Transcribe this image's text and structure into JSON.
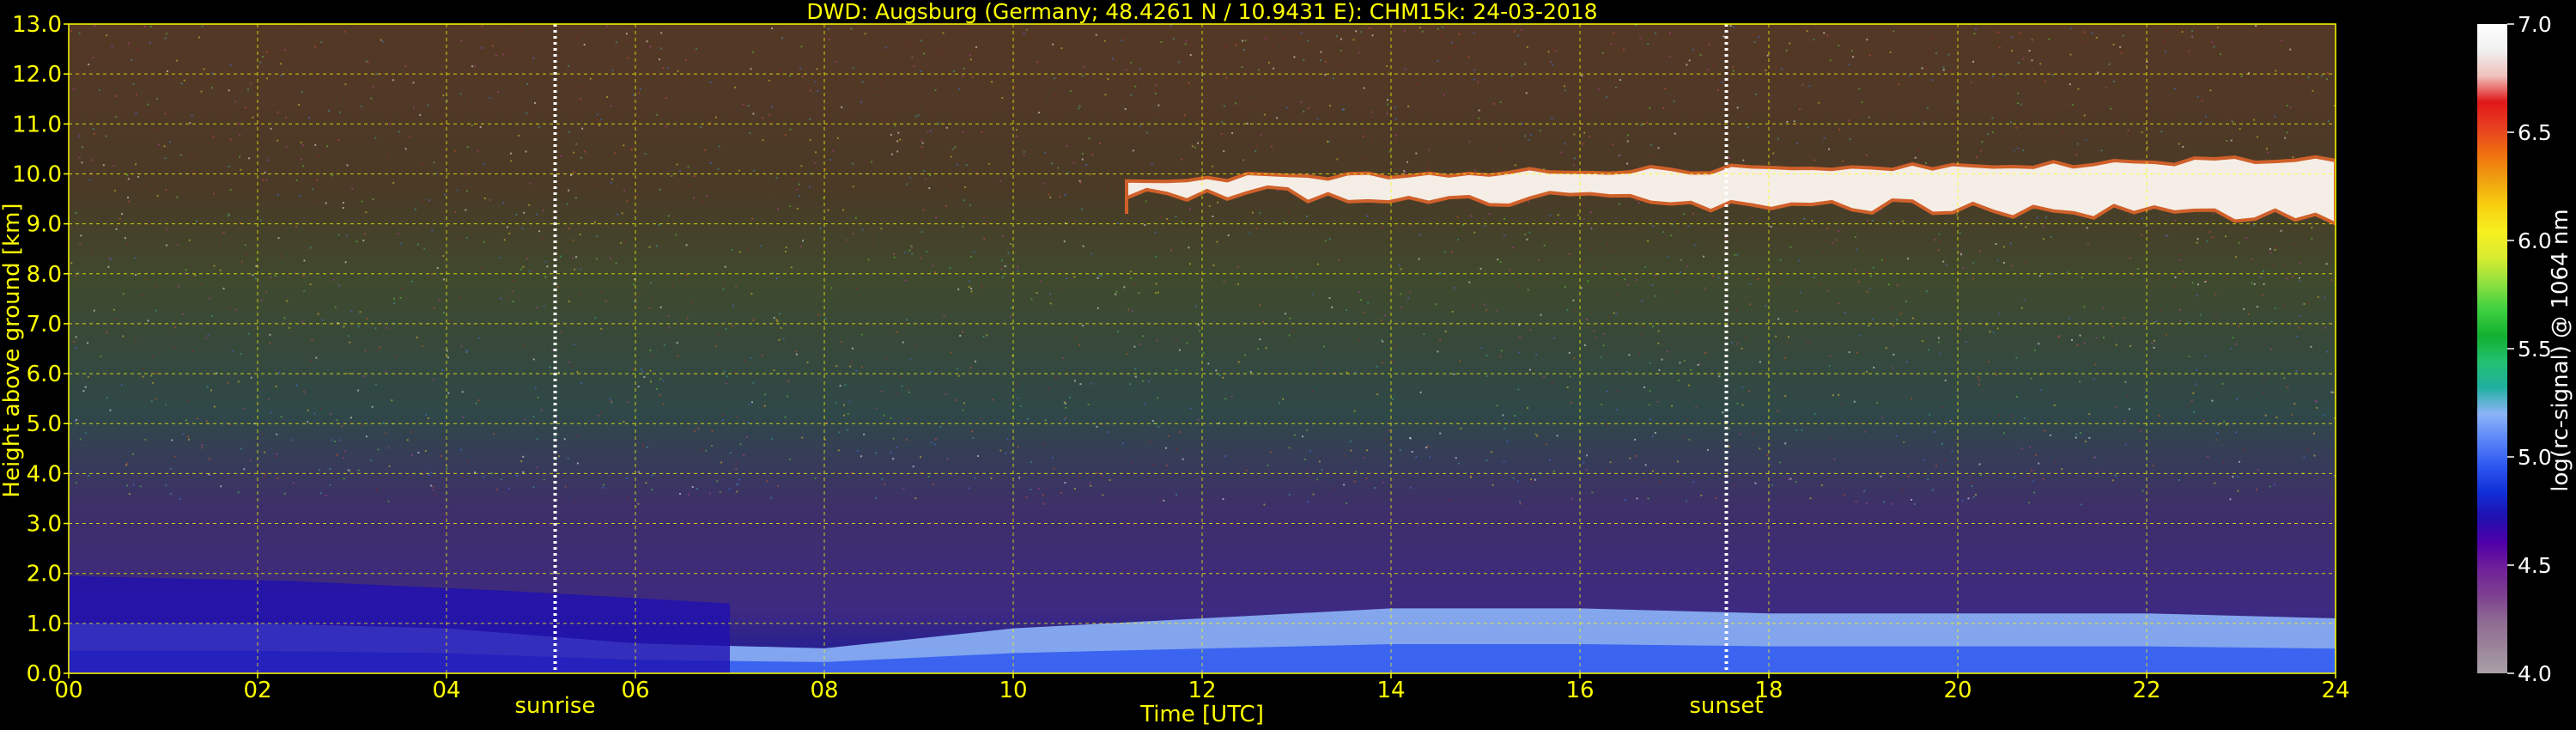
{
  "chart_data": {
    "type": "heatmap",
    "title": "DWD: Augsburg (Germany; 48.4261 N / 10.9431 E):    CHM15k: 24-03-2018",
    "xlabel": "Time [UTC]",
    "ylabel": "Height above ground [km]",
    "xlim": [
      0,
      24
    ],
    "ylim": [
      0.0,
      13.0
    ],
    "x_ticks": [
      "00",
      "02",
      "04",
      "06",
      "08",
      "10",
      "12",
      "14",
      "16",
      "18",
      "20",
      "22",
      "24"
    ],
    "x_tick_values": [
      0,
      2,
      4,
      6,
      8,
      10,
      12,
      14,
      16,
      18,
      20,
      22,
      24
    ],
    "y_ticks": [
      "0.0",
      "1.0",
      "2.0",
      "3.0",
      "4.0",
      "5.0",
      "6.0",
      "7.0",
      "8.0",
      "9.0",
      "10.0",
      "11.0",
      "12.0",
      "13.0"
    ],
    "y_tick_values": [
      0,
      1,
      2,
      3,
      4,
      5,
      6,
      7,
      8,
      9,
      10,
      11,
      12,
      13
    ],
    "grid": true,
    "grid_color": "#ffff00",
    "annotations": [
      {
        "label": "sunrise",
        "x": 5.15
      },
      {
        "label": "sunset",
        "x": 17.55
      }
    ],
    "colorbar": {
      "label": "log(rc-signal) @ 1064 nm",
      "range": [
        4.0,
        7.0
      ],
      "ticks": [
        "4.0",
        "4.5",
        "5.0",
        "5.5",
        "6.0",
        "6.5",
        "7.0"
      ],
      "tick_values": [
        4.0,
        4.5,
        5.0,
        5.5,
        6.0,
        6.5,
        7.0
      ],
      "colors": [
        "#a9a0a6",
        "#9b849a",
        "#8e6b93",
        "#7d3f8f",
        "#70229a",
        "#5000a8",
        "#2010b0",
        "#1030d8",
        "#2f58f0",
        "#5a86f8",
        "#8cb4f8",
        "#20b0a0",
        "#22c070",
        "#13b030",
        "#3ed040",
        "#8ce040",
        "#d8ec30",
        "#f8f020",
        "#f8d010",
        "#f0a010",
        "#f07010",
        "#e84020",
        "#e01818",
        "#f0c0bc",
        "#f0f0f0",
        "#ffffff"
      ]
    },
    "features": [
      {
        "name": "boundary layer",
        "x_range": [
          0,
          24
        ],
        "top_km": [
          1.0,
          1.0,
          0.9,
          0.6,
          0.5,
          0.9,
          1.1,
          1.3,
          1.3,
          1.2,
          1.2,
          1.2,
          1.1
        ],
        "signal": [
          5.2,
          5.0
        ]
      },
      {
        "name": "residual layer",
        "x_range": [
          0,
          7
        ],
        "top_km": [
          1.95,
          1.85,
          1.65,
          1.4
        ],
        "signal": 4.75
      },
      {
        "name": "cirrus cloud",
        "x_range": [
          11.2,
          24
        ],
        "base_km": 9.0,
        "top_km": 10.3,
        "signal": 6.3
      }
    ]
  }
}
